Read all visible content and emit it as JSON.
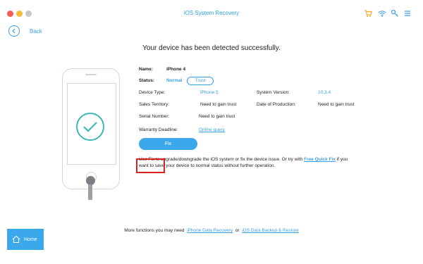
{
  "window": {
    "title": "iOS System Recovery"
  },
  "toolbar_icons": [
    "cart-icon",
    "wifi-icon",
    "key-icon",
    "menu-icon"
  ],
  "nav": {
    "back_label": "Back"
  },
  "headline": "Your device has been detected successfully.",
  "device": {
    "name_label": "Name:",
    "name_value": "iPhone 4",
    "status_label": "Status:",
    "status_value": "Normal",
    "trust_label": "Trust",
    "type_label": "Device Type:",
    "type_value": "iPhone 5",
    "version_label": "System Version:",
    "version_value": "10.3.4",
    "territory_label": "Sales Territory:",
    "territory_value": "Need to gain trust",
    "production_label": "Date of Production:",
    "production_value": "Need to gain trust",
    "serial_label": "Serial Number:",
    "serial_value": "Need to gain trust",
    "warranty_label": "Warranty Deadline:",
    "warranty_value": "Online query"
  },
  "fix": {
    "button_label": "Fix",
    "note_prefix": "Use Fix to upgrade/downgrade the iOS system or fix the device issue. Or try with ",
    "note_link": "Free Quick Fix",
    "note_suffix": " if you want to save your device to normal status without further operation."
  },
  "footer": {
    "more_label": "More functions you may need",
    "link1": "iPhone Data Recovery",
    "or_label": "or",
    "link2": "iOS Data Backup & Restore",
    "home_label": "Home"
  },
  "colors": {
    "accent": "#3aa8ea",
    "highlight": "#d8201f",
    "check": "#3fb9b5"
  }
}
